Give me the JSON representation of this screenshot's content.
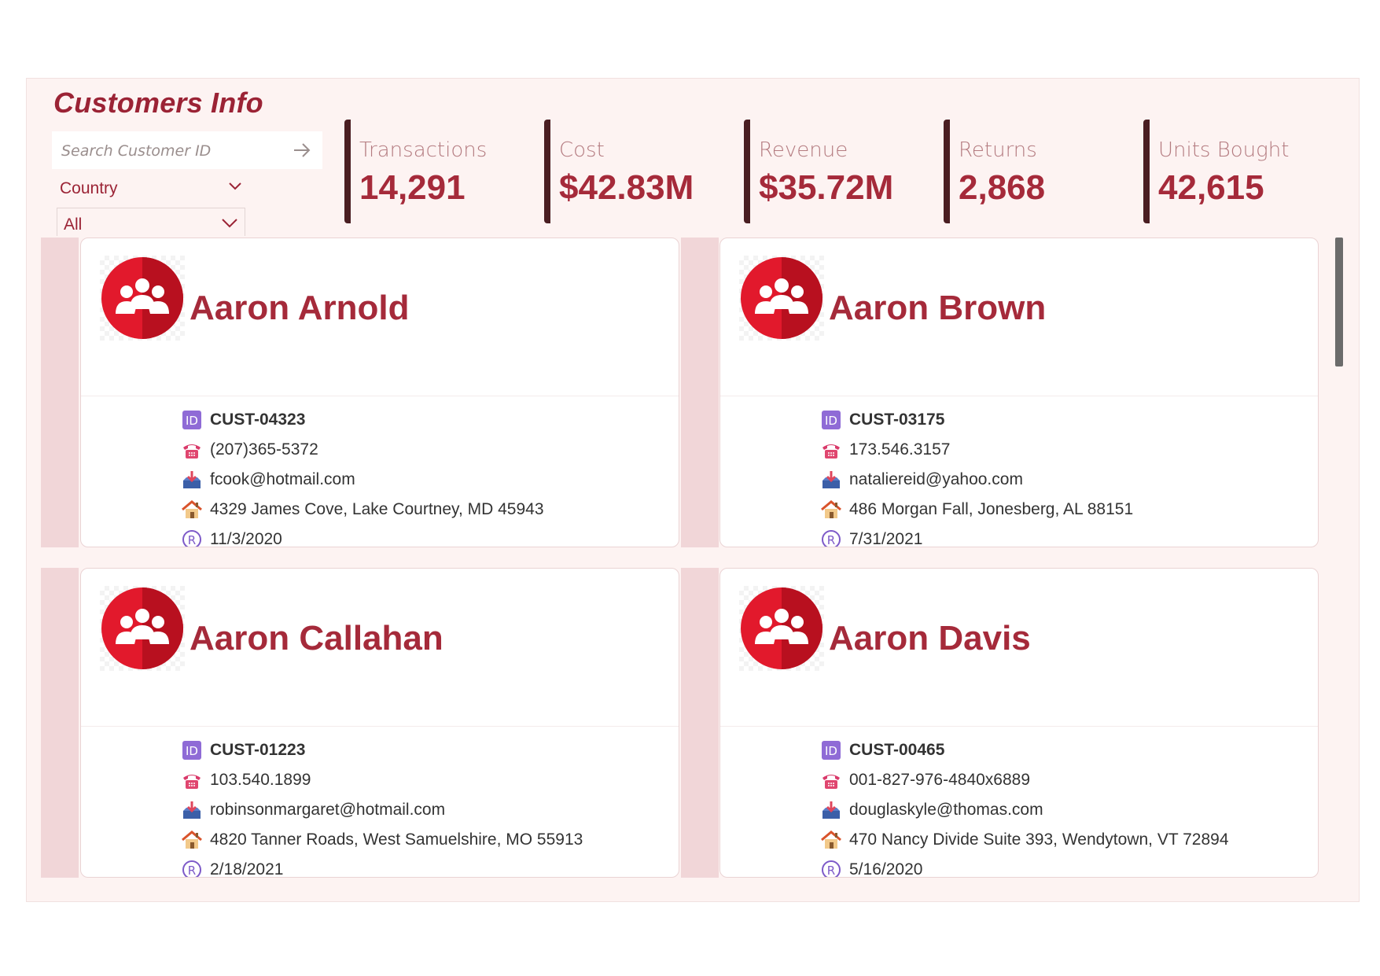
{
  "header": {
    "title": "Customers Info"
  },
  "filters": {
    "search_placeholder": "Search Customer ID",
    "country_label": "Country",
    "country_value": "All"
  },
  "kpis": [
    {
      "label": "Transactions",
      "value": "14,291"
    },
    {
      "label": "Cost",
      "value": "$42.83M"
    },
    {
      "label": "Revenue",
      "value": "$35.72M"
    },
    {
      "label": "Returns",
      "value": "2,868"
    },
    {
      "label": "Units Bought",
      "value": "42,615"
    }
  ],
  "customers": [
    {
      "name": "Aaron Arnold",
      "id": "CUST-04323",
      "phone": "(207)365-5372",
      "email": "fcook@hotmail.com",
      "address": "4329 James Cove, Lake Courtney, MD 45943",
      "registered": "11/3/2020"
    },
    {
      "name": "Aaron Brown",
      "id": "CUST-03175",
      "phone": "173.546.3157",
      "email": "natalie​reid@yahoo.com",
      "address": "486 Morgan Fall, Jonesberg, AL 88151",
      "registered": "7/31/2021"
    },
    {
      "name": "Aaron Callahan",
      "id": "CUST-01223",
      "phone": "103.540.1899",
      "email": "robinsonmargaret@hotmail.com",
      "address": "4820 Tanner Roads, West Samuelshire, MO 55913",
      "registered": "2/18/2021"
    },
    {
      "name": "Aaron Davis",
      "id": "CUST-00465",
      "phone": "001-827-976-4840x6889",
      "email": "douglaskyle@thomas.com",
      "address": "470 Nancy Divide Suite 393, Wendytown, VT 72894",
      "registered": "5/16/2020"
    }
  ],
  "icons": {
    "search_arrow": "arrow-right-icon",
    "dropdown": "chevron-down-icon",
    "avatar": "customer-group-icon",
    "id": "id-badge-icon",
    "phone": "telephone-icon",
    "email": "inbox-icon",
    "address": "house-icon",
    "registered": "registered-icon"
  },
  "colors": {
    "accent": "#a52a3a",
    "panel_bg": "#fdf3f2",
    "card_strip": "#f1d6d8",
    "kpi_bar": "#4a1e22"
  }
}
